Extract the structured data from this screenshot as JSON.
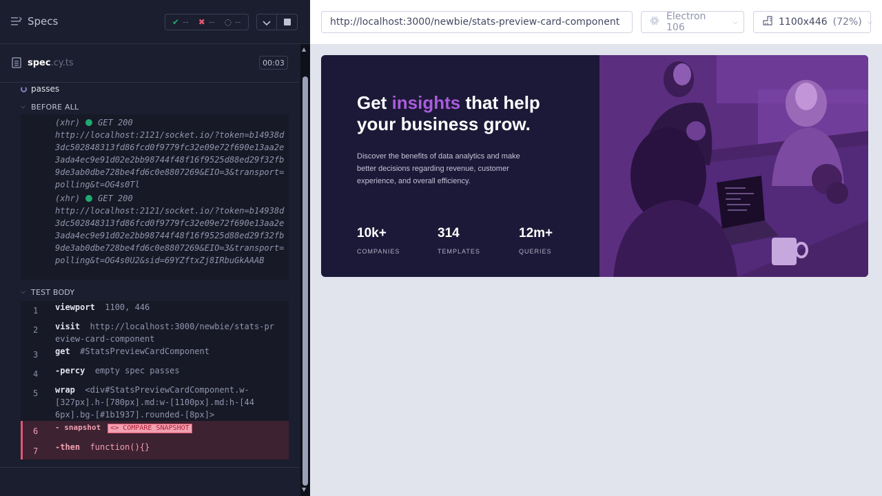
{
  "reporter": {
    "specs_label": "Specs",
    "stats": {
      "passed": "--",
      "failed": "--",
      "pending": "--"
    },
    "spec": {
      "name": "spec",
      "ext": ".cy.ts",
      "duration": "00:03"
    },
    "test_title": "passes",
    "before_all": {
      "label": "BEFORE ALL",
      "requests": [
        {
          "type": "(xhr)",
          "status": "GET 200",
          "url": "http://localhost:2121/socket.io/?token=b14938d3dc502848313fd86fcd0f9779fc32e09e72f690e13aa2e3ada4ec9e91d02e2bb98744f48f16f9525d88ed29f32fb9de3ab0dbe728be4fd6c0e8807269&EIO=3&transport=polling&t=OG4s0Tl"
        },
        {
          "type": "(xhr)",
          "status": "GET 200",
          "url": "http://localhost:2121/socket.io/?token=b14938d3dc502848313fd86fcd0f9779fc32e09e72f690e13aa2e3ada4ec9e91d02e2bb98744f48f16f9525d88ed29f32fb9de3ab0dbe728be4fd6c0e8807269&EIO=3&transport=polling&t=OG4s0U2&sid=69YZftxZj8IRbuGkAAAB"
        }
      ]
    },
    "test_body": {
      "label": "TEST BODY",
      "commands": [
        {
          "num": "1",
          "name": "viewport",
          "message": "1100, 446"
        },
        {
          "num": "2",
          "name": "visit",
          "message": "http://localhost:3000/newbie/stats-preview-card-component"
        },
        {
          "num": "3",
          "name": "get",
          "message": "#StatsPreviewCardComponent"
        },
        {
          "num": "4",
          "name": "-percy",
          "message": "empty spec passes"
        },
        {
          "num": "5",
          "name": "wrap",
          "message": "<div#StatsPreviewCardComponent.w-[327px].h-[780px].md:w-[1100px].md:h-[446px].bg-[#1b1937].rounded-[8px]>"
        },
        {
          "num": "6",
          "name": "- snapshot",
          "message": "",
          "badge": "<> COMPARE SNAPSHOT"
        },
        {
          "num": "7",
          "name": "-then",
          "message": "function(){}"
        }
      ]
    }
  },
  "aut": {
    "url": "http://localhost:3000/newbie/stats-preview-card-component",
    "browser": "Electron 106",
    "viewport": "1100x446",
    "zoom": "(72%)"
  },
  "card": {
    "heading_pre": "Get ",
    "heading_accent": "insights",
    "heading_post": " that help your business grow.",
    "description": "Discover the benefits of data analytics and make better decisions regarding revenue, customer experience, and overall efficiency.",
    "stats": [
      {
        "value": "10k+",
        "label": "COMPANIES"
      },
      {
        "value": "314",
        "label": "TEMPLATES"
      },
      {
        "value": "12m+",
        "label": "QUERIES"
      }
    ]
  },
  "colors": {
    "card_bg": "#1b1937",
    "accent": "#aa5cdb",
    "image_tint": "#5b2e80",
    "failed_bg": "#3d2232",
    "failed_border": "#e45770",
    "success_dot": "#1fa971"
  }
}
